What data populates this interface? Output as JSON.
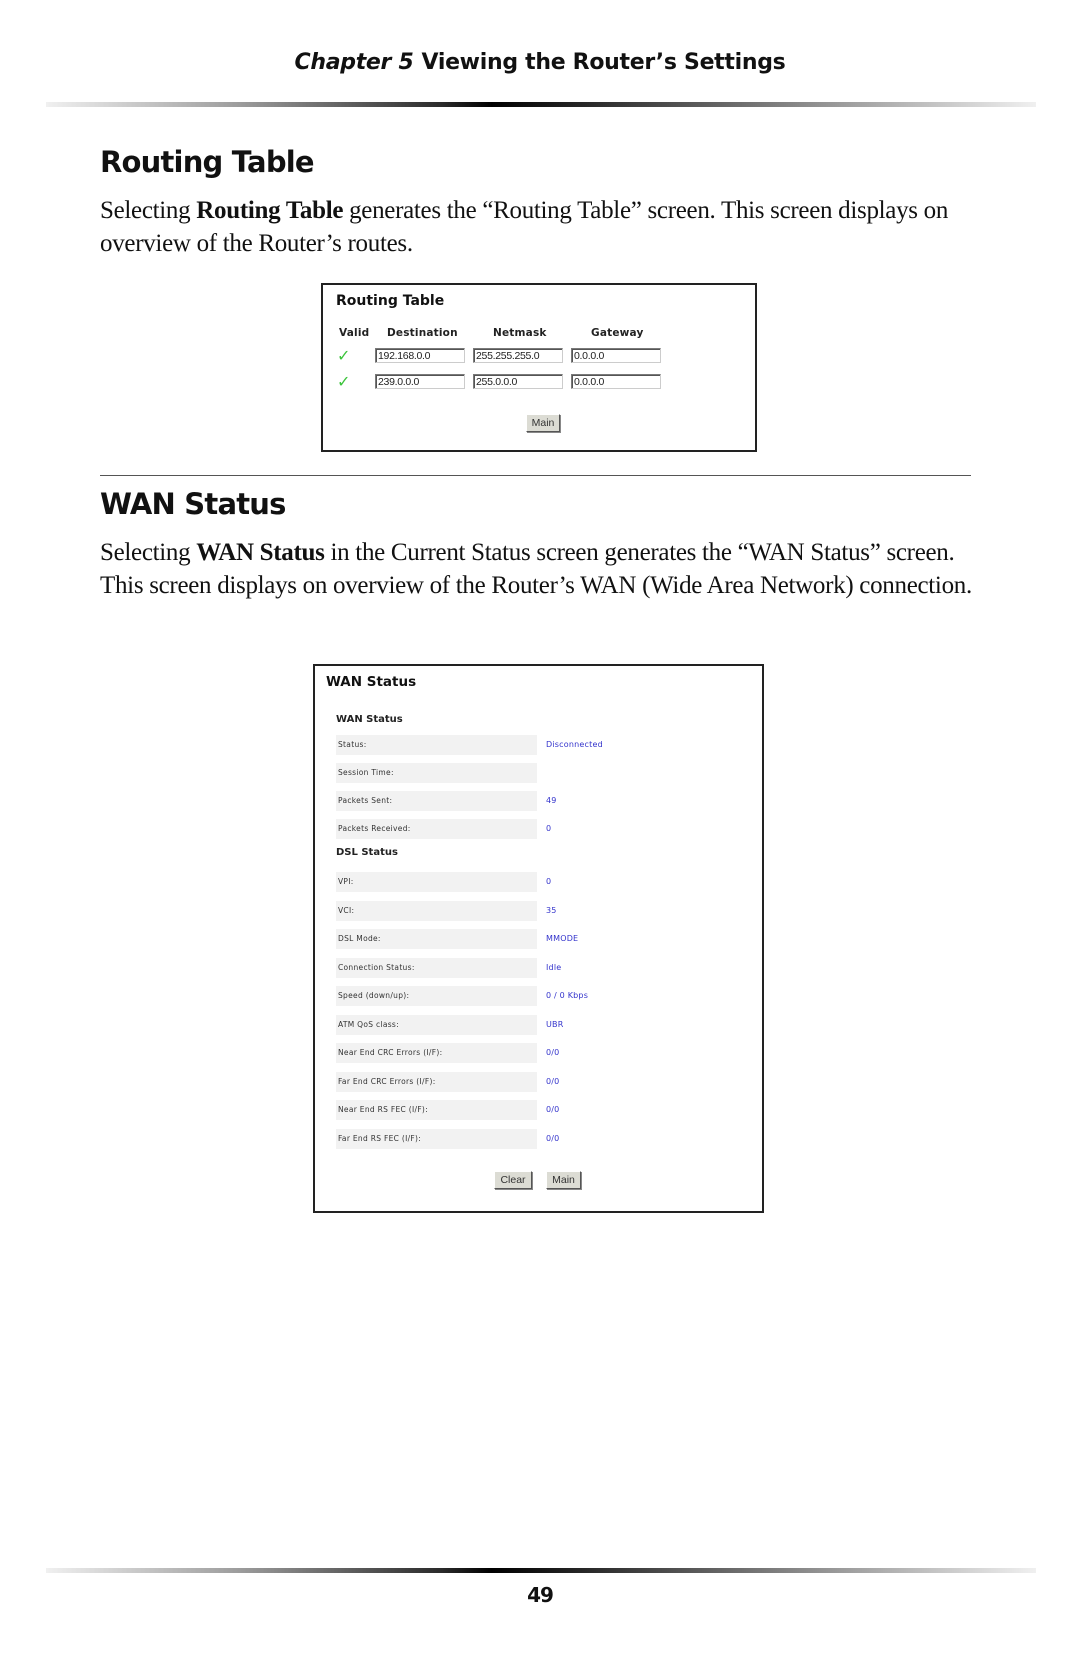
{
  "header": {
    "chapter_label": "Chapter 5",
    "chapter_title": "Viewing the Router’s Settings"
  },
  "routing_section": {
    "title": "Routing Table",
    "paragraph": {
      "pre": "Selecting ",
      "bold": "Routing Table",
      "post": " generates the “Routing Table” screen. This screen displays on overview of the Router’s routes."
    },
    "screenshot": {
      "title": "Routing Table",
      "columns": [
        "Valid",
        "Destination",
        "Netmask",
        "Gateway"
      ],
      "rows": [
        {
          "valid": "✓",
          "destination": "192.168.0.0",
          "netmask": "255.255.255.0",
          "gateway": "0.0.0.0"
        },
        {
          "valid": "✓",
          "destination": "239.0.0.0",
          "netmask": "255.0.0.0",
          "gateway": "0.0.0.0"
        }
      ],
      "main_button": "Main"
    }
  },
  "wan_section": {
    "title": "WAN Status",
    "paragraph": {
      "pre": "Selecting ",
      "bold": "WAN Status",
      "post": " in the Current Status screen generates the “WAN Status” screen. This screen displays on overview of the Router’s WAN (Wide Area Network) connection."
    },
    "screenshot": {
      "title": "WAN Status",
      "wan_group": {
        "heading": "WAN Status",
        "rows": [
          {
            "label": "Status:",
            "value": "Disconnected"
          },
          {
            "label": "Session Time:",
            "value": ""
          },
          {
            "label": "Packets Sent:",
            "value": "49"
          },
          {
            "label": "Packets Received:",
            "value": "0"
          }
        ]
      },
      "dsl_group": {
        "heading": "DSL Status",
        "rows": [
          {
            "label": "VPI:",
            "value": "0"
          },
          {
            "label": "VCI:",
            "value": "35"
          },
          {
            "label": "DSL Mode:",
            "value": "MMODE"
          },
          {
            "label": "Connection Status:",
            "value": "Idle"
          },
          {
            "label": "Speed (down/up):",
            "value": "0 / 0 Kbps"
          },
          {
            "label": "ATM QoS class:",
            "value": "UBR"
          },
          {
            "label": "Near End CRC Errors (I/F):",
            "value": "0/0"
          },
          {
            "label": "Far End CRC Errors (I/F):",
            "value": "0/0"
          },
          {
            "label": "Near End RS FEC (I/F):",
            "value": "0/0"
          },
          {
            "label": "Far End RS FEC (I/F):",
            "value": "0/0"
          }
        ]
      },
      "clear_button": "Clear",
      "main_button": "Main"
    }
  },
  "footer": {
    "page_number": "49"
  },
  "colors": {
    "value_text": "#3333cc",
    "check": "#3cc43c",
    "label_bg": "#f2f2f2"
  }
}
